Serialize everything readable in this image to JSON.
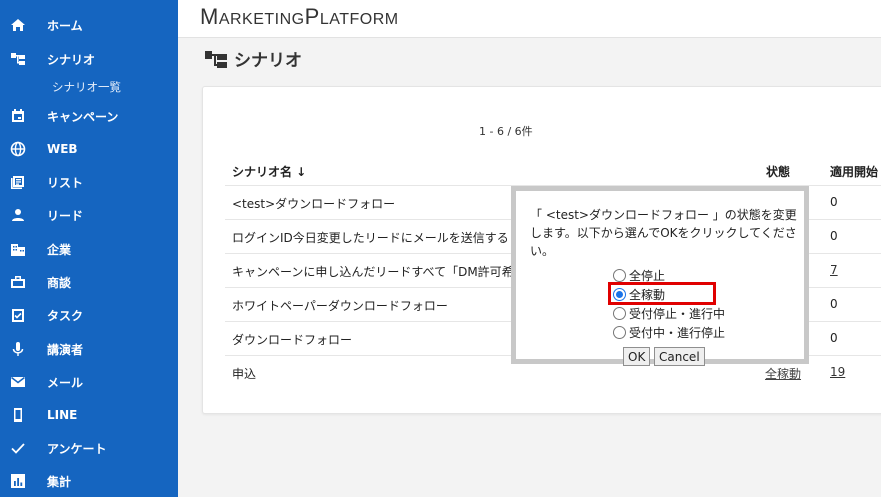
{
  "sidebar": {
    "items": [
      {
        "label": "ホーム",
        "icon": "home-icon"
      },
      {
        "label": "シナリオ",
        "icon": "scenario-icon"
      },
      {
        "label": "キャンペーン",
        "icon": "calendar-icon"
      },
      {
        "label": "WEB",
        "icon": "globe-icon"
      },
      {
        "label": "リスト",
        "icon": "list-icon"
      },
      {
        "label": "リード",
        "icon": "person-icon"
      },
      {
        "label": "企業",
        "icon": "building-icon"
      },
      {
        "label": "商談",
        "icon": "briefcase-icon"
      },
      {
        "label": "タスク",
        "icon": "task-icon"
      },
      {
        "label": "講演者",
        "icon": "microphone-icon"
      },
      {
        "label": "メール",
        "icon": "mail-icon"
      },
      {
        "label": "LINE",
        "icon": "phone-icon"
      },
      {
        "label": "アンケート",
        "icon": "check-icon"
      },
      {
        "label": "集計",
        "icon": "bar-chart-icon"
      }
    ],
    "sub_item": "シナリオ一覧"
  },
  "header": {
    "logo_m": "M",
    "logo_arketing": "ARKETING",
    "logo_p": "P",
    "logo_latform": "LATFORM"
  },
  "page": {
    "title": "シナリオ"
  },
  "table": {
    "pager": "1 - 6 / 6件",
    "headers": {
      "name": "シナリオ名 ↓",
      "status": "状態",
      "start": "適用開始"
    },
    "rows": [
      {
        "name": "<test>ダウンロードフォロー",
        "status": "",
        "count": "0",
        "count_link": false
      },
      {
        "name": "ログインID今日変更したリードにメールを送信する",
        "status": "",
        "count": "0",
        "count_link": false
      },
      {
        "name": "キャンペーンに申し込んだリードすべて「DM許可希",
        "status": "",
        "count": "7",
        "count_link": true
      },
      {
        "name": "ホワイトペーパーダウンロードフォロー",
        "status": "",
        "count": "0",
        "count_link": false
      },
      {
        "name": "ダウンロードフォロー",
        "status": "",
        "count": "0",
        "count_link": false
      },
      {
        "name": "申込",
        "status": "全稼動",
        "count": "19",
        "count_link": true
      }
    ]
  },
  "dialog": {
    "message": "「 <test>ダウンロードフォロー 」の状態を変更します。以下から選んでOKをクリックしてください。",
    "options": [
      "全停止",
      "全稼動",
      "受付停止・進行中",
      "受付中・進行停止"
    ],
    "selected_index": 1,
    "ok_label": "OK",
    "cancel_label": "Cancel"
  },
  "colors": {
    "sidebar": "#1565c0",
    "highlight": "#e00000"
  }
}
